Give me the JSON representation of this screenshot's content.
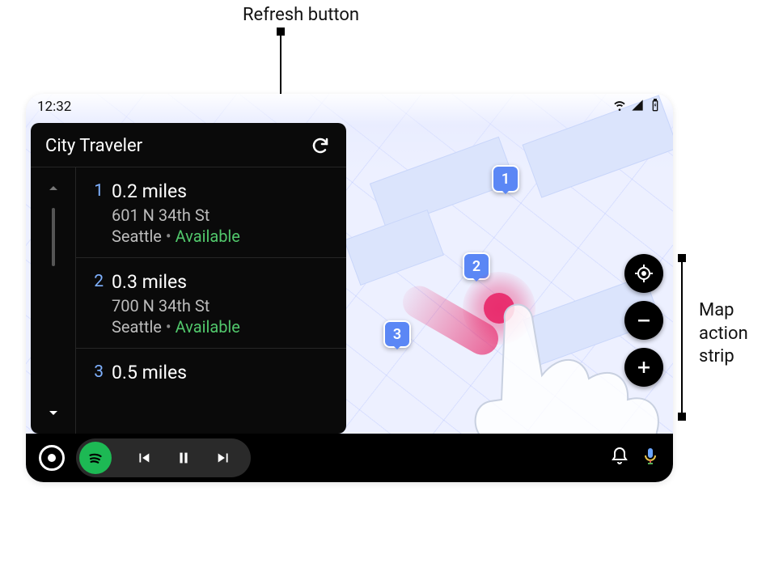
{
  "annotations": {
    "refresh": "Refresh button",
    "action_strip": "Map action strip"
  },
  "statusbar": {
    "time": "12:32"
  },
  "panel": {
    "title": "City Traveler"
  },
  "list": {
    "items": [
      {
        "num": "1",
        "distance": "0.2 miles",
        "address": "601 N 34th St",
        "city": "Seattle",
        "status": "Available"
      },
      {
        "num": "2",
        "distance": "0.3 miles",
        "address": "700 N 34th St",
        "city": "Seattle",
        "status": "Available"
      },
      {
        "num": "3",
        "distance": "0.5 miles",
        "address": "",
        "city": "",
        "status": ""
      }
    ]
  },
  "markers": {
    "m1": "1",
    "m2": "2",
    "m3": "3"
  }
}
